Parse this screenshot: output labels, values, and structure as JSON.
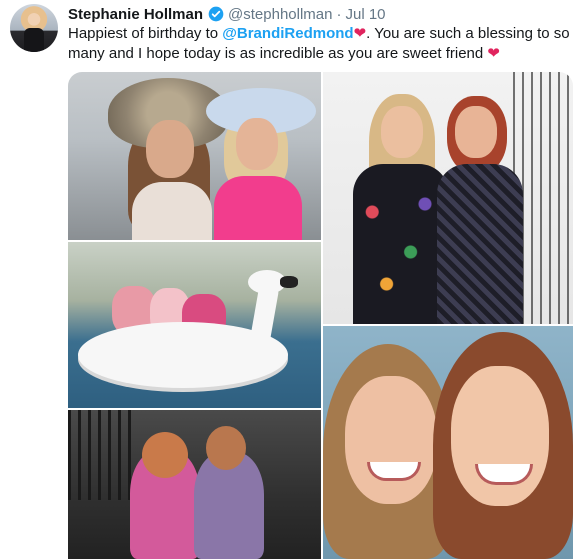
{
  "tweet": {
    "author_name": "Stephanie Hollman",
    "handle": "@stephhollman",
    "separator": "·",
    "date": "Jul 10",
    "text_before": "Happiest of birthday to ",
    "mention": "@BrandiRedmond",
    "heart1": "❤",
    "text_middle": ". You are such a blessing to so many and I hope today is as incredible as you are sweet friend ",
    "heart2": "❤"
  },
  "colors": {
    "mention": "#1da1f2",
    "heart": "#e0245e",
    "verified": "#1da1f2",
    "secondary_text": "#657786"
  },
  "media": {
    "photos": [
      "hats-photo",
      "dresses-photo",
      "swan-float-photo",
      "selfie-photo",
      "night-photo"
    ]
  }
}
